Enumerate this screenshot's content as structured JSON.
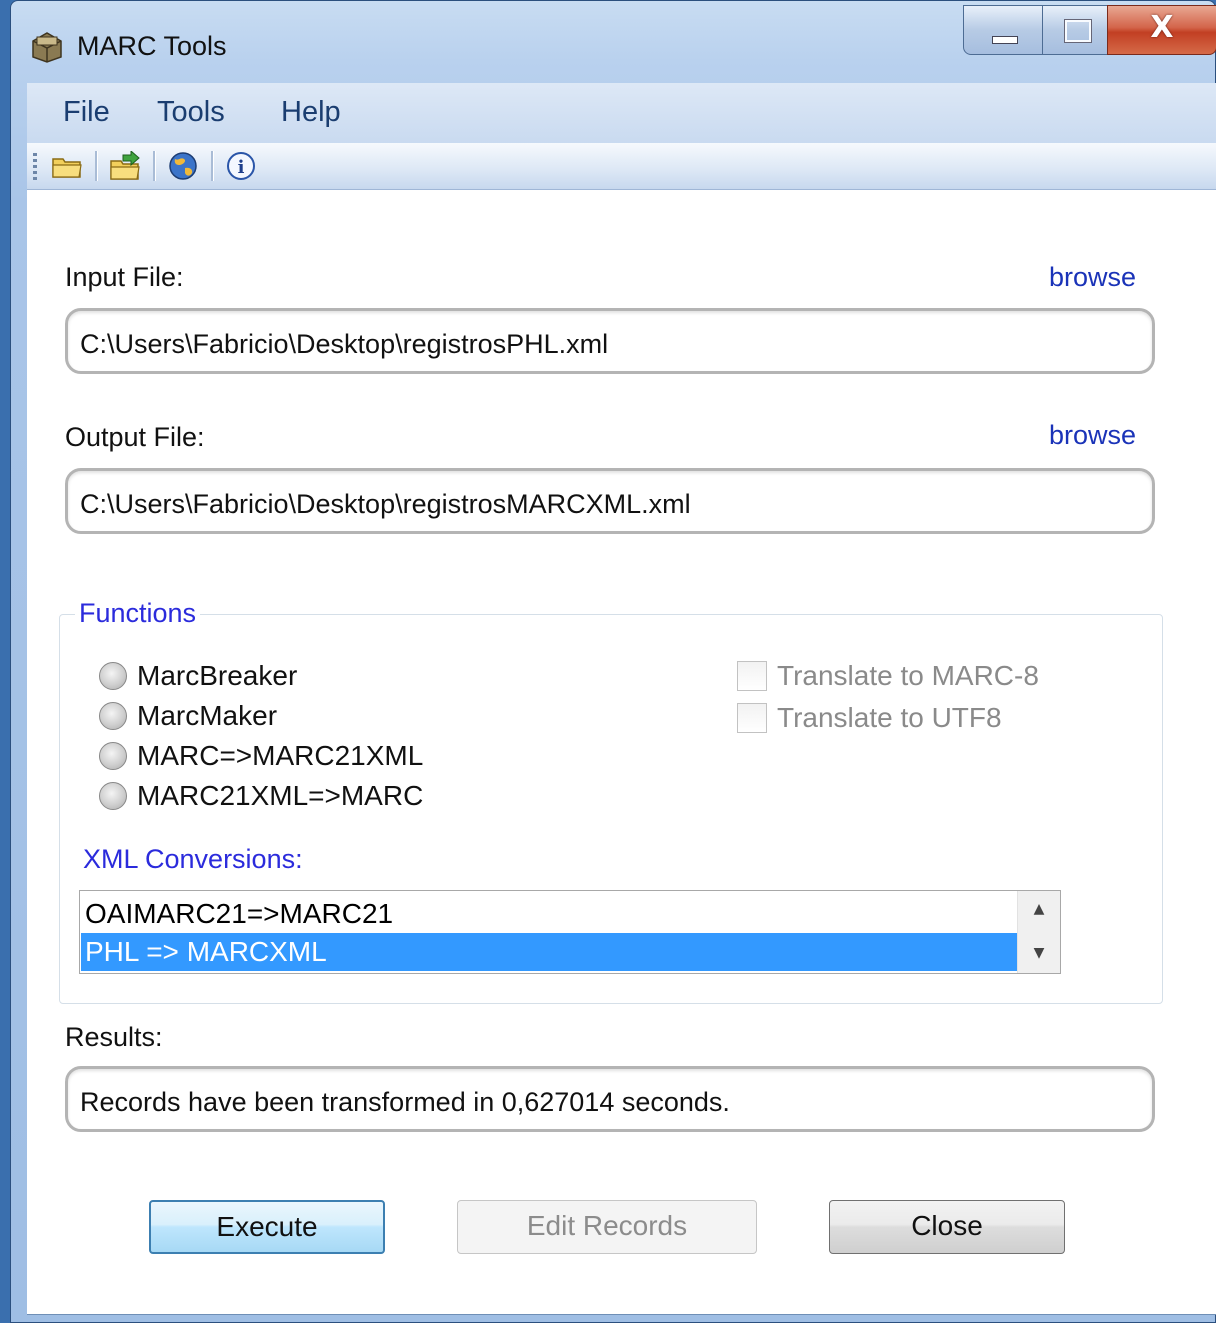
{
  "window": {
    "title": "MARC Tools",
    "close_glyph": "X"
  },
  "menu": {
    "items": [
      "File",
      "Tools",
      "Help"
    ]
  },
  "toolbar": {
    "icons": [
      "open-folder-icon",
      "export-folder-icon",
      "globe-icon",
      "info-icon"
    ]
  },
  "input": {
    "label": "Input File:",
    "browse": "browse",
    "value": "C:\\Users\\Fabricio\\Desktop\\registrosPHL.xml"
  },
  "output": {
    "label": "Output File:",
    "browse": "browse",
    "value": "C:\\Users\\Fabricio\\Desktop\\registrosMARCXML.xml"
  },
  "functions": {
    "legend": "Functions",
    "radios": [
      "MarcBreaker",
      "MarcMaker",
      "MARC=>MARC21XML",
      "MARC21XML=>MARC"
    ],
    "checks": [
      "Translate to MARC-8",
      "Translate to UTF8"
    ],
    "xml_label": "XML Conversions:",
    "xml_items": [
      "OAIMARC21=>MARC21",
      "PHL => MARCXML"
    ],
    "xml_selected": 1
  },
  "results": {
    "label": "Results:",
    "value": "Records have been transformed in 0,627014 seconds."
  },
  "buttons": {
    "execute": "Execute",
    "edit": "Edit Records",
    "close": "Close"
  },
  "colors": {
    "link": "#1a33b8",
    "group_label": "#2b2bdc",
    "selection": "#3399ff"
  }
}
